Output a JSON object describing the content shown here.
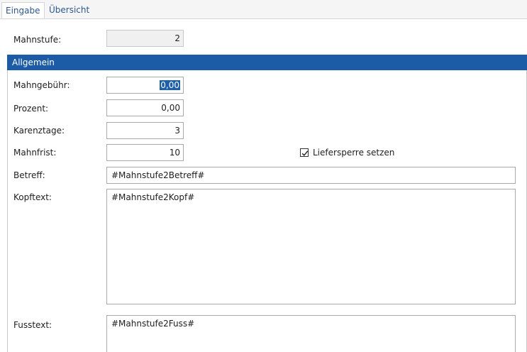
{
  "tabs": [
    {
      "label": "Eingabe",
      "active": true
    },
    {
      "label": "Übersicht",
      "active": false
    }
  ],
  "header": {
    "mahnstufe_label": "Mahnstufe:",
    "mahnstufe_value": "2"
  },
  "group": {
    "title": "Allgemein",
    "mahngebuehr_label": "Mahngebühr:",
    "mahngebuehr_value": "0,00",
    "prozent_label": "Prozent:",
    "prozent_value": "0,00",
    "karenztage_label": "Karenztage:",
    "karenztage_value": "3",
    "mahnfrist_label": "Mahnfrist:",
    "mahnfrist_value": "10",
    "liefersperre_label": "Liefersperre setzen",
    "liefersperre_checked": true,
    "betreff_label": "Betreff:",
    "betreff_value": "#Mahnstufe2Betreff#",
    "kopftext_label": "Kopftext:",
    "kopftext_value": "#Mahnstufe2Kopf#",
    "fusstext_label": "Fusstext:",
    "fusstext_value": "#Mahnstufe2Fuss#"
  },
  "colors": {
    "group_header": "#1c5ca7",
    "tab_text": "#2b5797",
    "selection": "#1c5fae"
  }
}
